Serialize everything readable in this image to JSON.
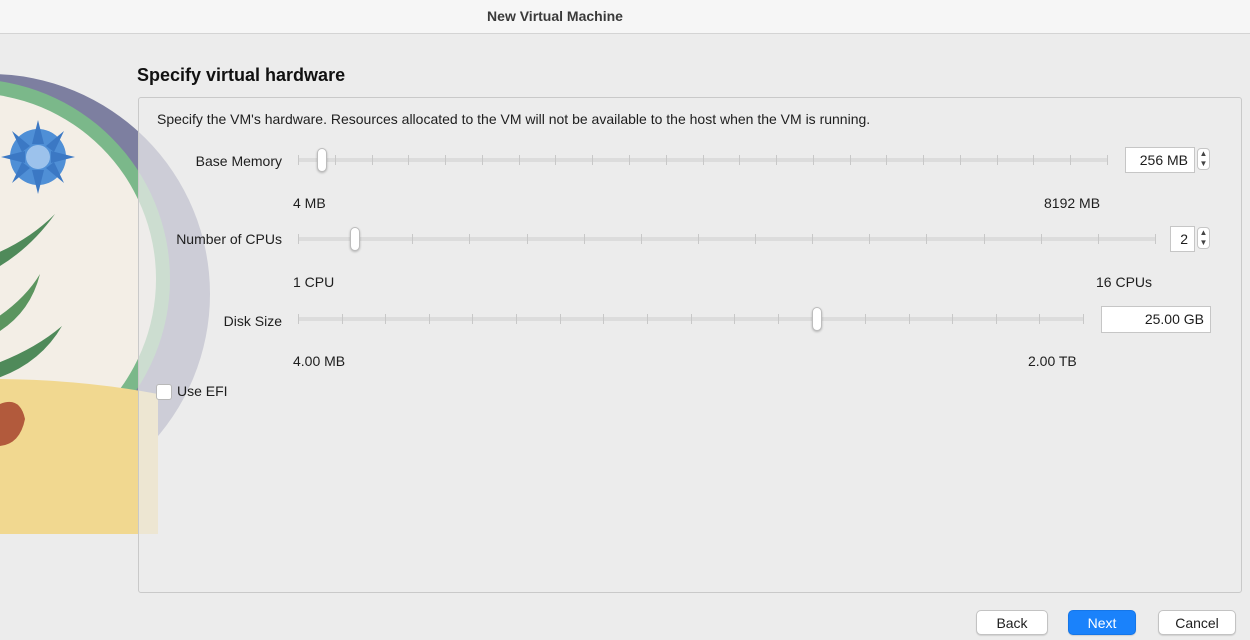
{
  "window": {
    "title": "New Virtual Machine"
  },
  "page": {
    "title": "Specify virtual hardware",
    "description": "Specify the VM's hardware. Resources allocated to the VM will not be available to the host when the VM is running."
  },
  "memory": {
    "label": "Base Memory",
    "min_label": "4 MB",
    "max_label": "8192 MB",
    "value": "256 MB",
    "fraction": 0.03
  },
  "cpus": {
    "label": "Number of CPUs",
    "min_label": "1 CPU",
    "max_label": "16 CPUs",
    "value": "2",
    "fraction": 0.067
  },
  "disk": {
    "label": "Disk Size",
    "min_label": "4.00 MB",
    "max_label": "2.00 TB",
    "value": "25.00 GB",
    "fraction": 0.66
  },
  "efi": {
    "label": "Use EFI",
    "checked": false
  },
  "buttons": {
    "back": "Back",
    "next": "Next",
    "cancel": "Cancel"
  },
  "colors": {
    "accent": "#1a82fb",
    "background": "#ececec"
  }
}
